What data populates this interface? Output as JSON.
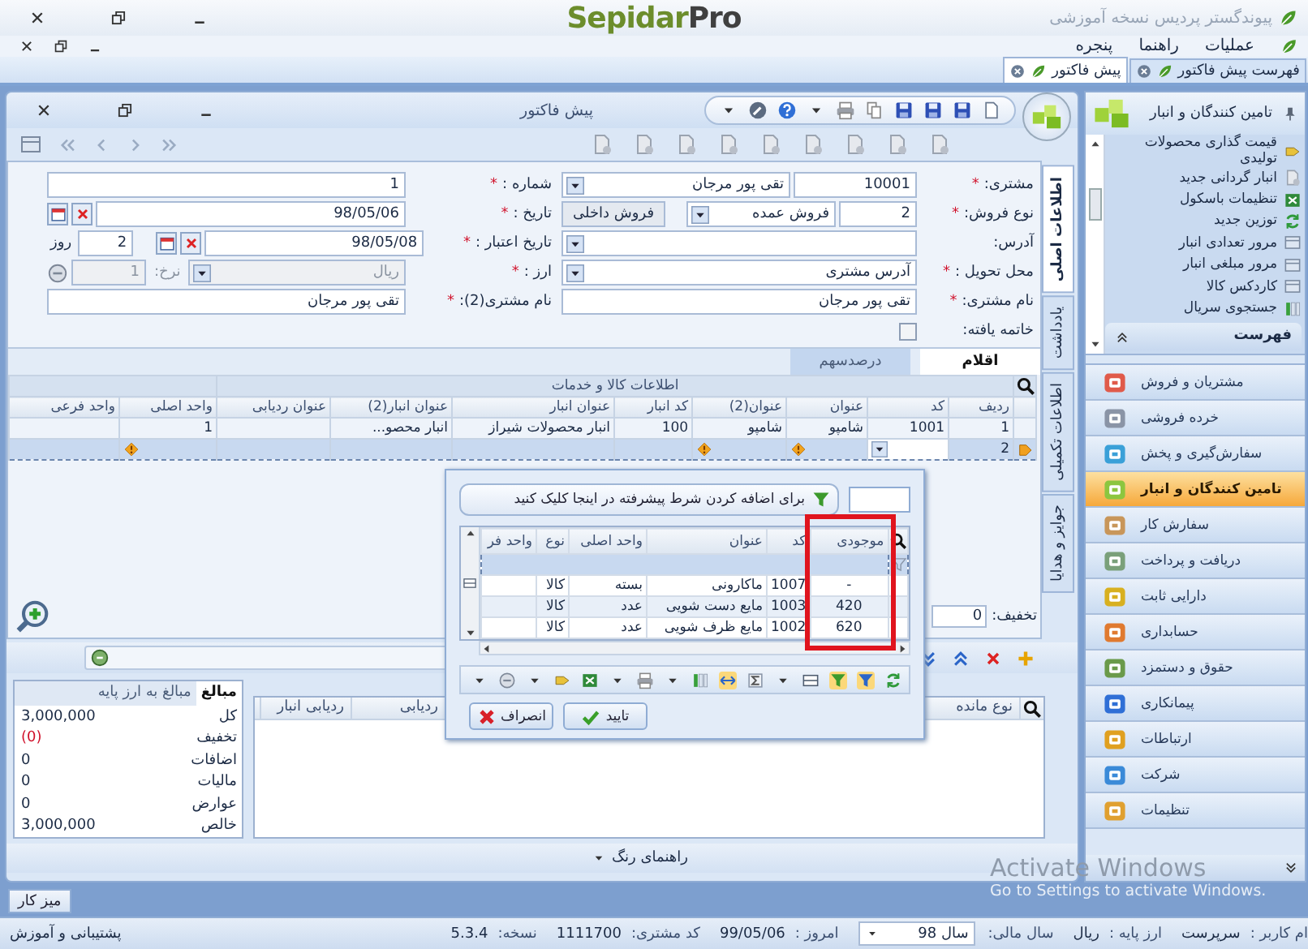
{
  "window": {
    "title": "پیوندگستر پردیس نسخه آموزشی",
    "logo": {
      "name": "Sepidar",
      "suffix": "Pro"
    }
  },
  "menu": [
    {
      "label": "عملیات"
    },
    {
      "label": "راهنما"
    },
    {
      "label": "پنجره"
    }
  ],
  "doc_tabs": [
    {
      "label": "فهرست پیش فاکتور",
      "selected": false
    },
    {
      "label": "پیش فاکتور",
      "selected": true
    }
  ],
  "invoice": {
    "title": "پیش فاکتور",
    "side_tabs": [
      {
        "label": "اطلاعات اصلی",
        "selected": true
      },
      {
        "label": "یادداشت",
        "selected": false
      },
      {
        "label": "اطلاعات تکمیلی",
        "selected": false
      },
      {
        "label": "جوایز و هدایا",
        "selected": false
      }
    ],
    "fields_right": [
      {
        "kind": "lookup",
        "label": "مشتری:",
        "mark": "*",
        "code": "10001",
        "value": "تقی پور مرجان"
      },
      {
        "kind": "combo",
        "label": "نوع فروش:",
        "mark": "*",
        "code": "2",
        "value": "فروش عمده",
        "extra": "فروش داخلی"
      },
      {
        "kind": "dropdown",
        "label": "آدرس:"
      },
      {
        "kind": "dropdown",
        "label": "محل تحویل :",
        "mark": "*",
        "value": "آدرس مشتری"
      },
      {
        "kind": "text",
        "label": "نام مشتری:",
        "mark": "*",
        "value": "تقی پور مرجان"
      },
      {
        "kind": "checkbox",
        "label": "خاتمه یافته:",
        "checked": false
      }
    ],
    "fields_left": [
      {
        "kind": "text",
        "label": "شماره :",
        "mark": "*",
        "value": "1"
      },
      {
        "kind": "date",
        "label": "تاریخ :",
        "mark": "*",
        "value": "98/05/06"
      },
      {
        "kind": "date",
        "label": "تاریخ اعتبار :",
        "mark": "*",
        "value": "98/05/08",
        "days": "2",
        "unit": "روز"
      },
      {
        "kind": "currency",
        "label": "ارز :",
        "mark": "*",
        "value": "ریال",
        "rate_label": "نرخ:",
        "rate": "1",
        "disabled": true
      },
      {
        "kind": "text",
        "label": "نام مشتری(2):",
        "mark": "*",
        "value": "تقی پور مرجان"
      }
    ],
    "item_tabs": [
      {
        "label": "اقلام",
        "selected": true
      },
      {
        "label": "درصدسهم",
        "selected": false
      }
    ],
    "items_grid": {
      "group_header": "اطلاعات کالا و خدمات",
      "columns": [
        {
          "label": "ردیف",
          "required": false,
          "lookup": false
        },
        {
          "label": "کد",
          "required": false,
          "lookup": true
        },
        {
          "label": "عنوان",
          "required": true,
          "lookup": false
        },
        {
          "label": "عنوان(2)",
          "required": true,
          "lookup": false
        },
        {
          "label": "کد انبار",
          "required": false,
          "lookup": false
        },
        {
          "label": "عنوان انبار",
          "required": false,
          "lookup": false
        },
        {
          "label": "عنوان انبار(2)",
          "required": false,
          "lookup": false
        },
        {
          "label": "عنوان ردیابی",
          "required": false,
          "lookup": false
        },
        {
          "label": "واحد اصلی",
          "required": true,
          "lookup": false
        },
        {
          "label": "واحد فرعی",
          "required": false,
          "lookup": false
        }
      ],
      "rows": [
        {
          "cells": [
            "1",
            "1001",
            "شامپو",
            "شامپو",
            "100",
            "انبار محصولات شیراز",
            "انبار محصو...",
            null,
            "1",
            null
          ],
          "selected": false
        },
        {
          "cells": [
            "2",
            null,
            null,
            null,
            null,
            null,
            null,
            null,
            null,
            null
          ],
          "selected": true
        }
      ]
    },
    "discount": {
      "label": "تخفیف:",
      "value": "0"
    },
    "totals": {
      "tabs": [
        {
          "label": "مبالغ",
          "selected": true
        },
        {
          "label": "مبالغ به ارز پایه",
          "selected": false
        }
      ],
      "rows": [
        {
          "label": "کل",
          "value": "3,000,000",
          "negative": false
        },
        {
          "label": "تخفیف",
          "value": "(0)",
          "negative": true
        },
        {
          "label": "اضافات",
          "value": "0",
          "negative": false
        },
        {
          "label": "مالیات",
          "value": "0",
          "negative": false
        },
        {
          "label": "عوارض",
          "value": "0",
          "negative": false
        },
        {
          "label": "خالص",
          "value": "3,000,000",
          "negative": false
        }
      ]
    },
    "detail_columns": [
      {
        "label": "نوع مانده"
      },
      {
        "label": "ردیابی"
      },
      {
        "label": "ردیابی انبار"
      }
    ],
    "color_guide": "راهنمای رنگ"
  },
  "lookup_popup": {
    "filter_hint": "برای اضافه کردن شرط پیشرفته در اینجا کلیک کنید",
    "columns": [
      {
        "label": "موجودی",
        "highlighted": true
      },
      {
        "label": "کد",
        "highlighted": false
      },
      {
        "label": "عنوان",
        "highlighted": false
      },
      {
        "label": "واحد اصلی",
        "highlighted": false
      },
      {
        "label": "نوع",
        "highlighted": false
      },
      {
        "label": "واحد فر",
        "highlighted": false
      }
    ],
    "rows": [
      {
        "cells": [
          "-",
          "1007",
          "ماکارونی",
          "بسته",
          "کالا",
          null
        ],
        "selected": false
      },
      {
        "cells": [
          "420",
          "1003",
          "مایع دست شویی",
          "عدد",
          "کالا",
          null
        ],
        "selected": true
      },
      {
        "cells": [
          "620",
          "1002",
          "مایع ظرف شویی",
          "عدد",
          "کالا",
          null
        ],
        "selected": false
      }
    ],
    "buttons": [
      {
        "label": "تایید",
        "kind": "ok"
      },
      {
        "label": "انصراف",
        "kind": "cancel"
      }
    ]
  },
  "sidebar": {
    "title": "تامین کنندگان و انبار",
    "tasks": [
      "قیمت گذاری محصولات تولیدی",
      "انبار گردانی جدید",
      "تنظیمات باسکول",
      "توزین جدید",
      "مرور تعدادی انبار",
      "مرور مبلغی انبار",
      "کاردکس کالا",
      "جستجوی سریال"
    ],
    "section": "فهرست",
    "modules": [
      {
        "label": "مشتریان و فروش",
        "selected": false
      },
      {
        "label": "خرده فروشی",
        "selected": false
      },
      {
        "label": "سفارش‌گیری و پخش",
        "selected": false
      },
      {
        "label": "تامین کنندگان و انبار",
        "selected": true
      },
      {
        "label": "سفارش کار",
        "selected": false
      },
      {
        "label": "دریافت و پرداخت",
        "selected": false
      },
      {
        "label": "دارایی ثابت",
        "selected": false
      },
      {
        "label": "حسابداری",
        "selected": false
      },
      {
        "label": "حقوق و دستمزد",
        "selected": false
      },
      {
        "label": "پیمانکاری",
        "selected": false
      },
      {
        "label": "ارتباطات",
        "selected": false
      },
      {
        "label": "شرکت",
        "selected": false
      },
      {
        "label": "تنظیمات",
        "selected": false
      }
    ]
  },
  "desk_button": "میز کار",
  "status_bar": [
    {
      "label": "ام کاربر :",
      "value": "سرپرست",
      "kind": "text"
    },
    {
      "label": "ارز پایه :",
      "value": "ریال",
      "kind": "text"
    },
    {
      "label": "سال مالی:",
      "value": "سال 98",
      "kind": "dropdown"
    },
    {
      "label": "امروز :",
      "value": "99/05/06",
      "kind": "text"
    },
    {
      "label": "کد مشتری:",
      "value": "1111700",
      "kind": "text"
    },
    {
      "label": "نسخه:",
      "value": "5.3.4",
      "kind": "text"
    }
  ],
  "support_link": "پشتیبانی و آموزش",
  "os_watermark": [
    "Activate Windows",
    "Go to Settings to activate Windows."
  ]
}
